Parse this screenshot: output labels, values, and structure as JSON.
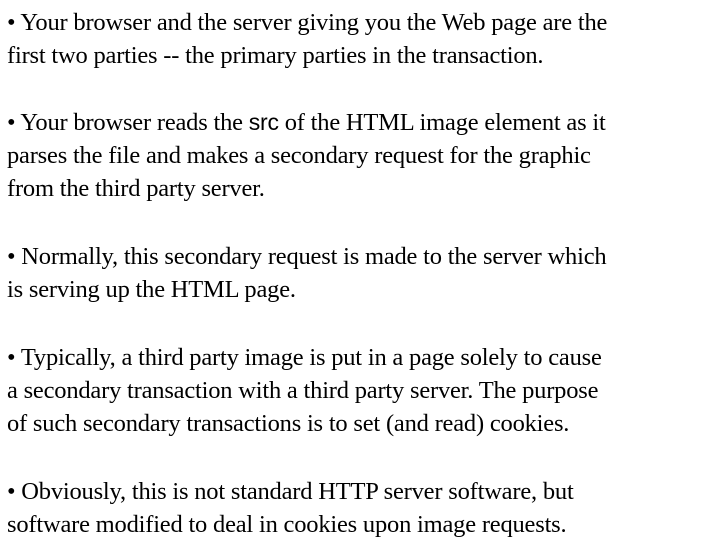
{
  "bullet": "•",
  "paragraphs": [
    {
      "lines": [
        "• Your browser and the server giving you the Web page are the",
        "first two parties -- the primary parties in the transaction."
      ]
    },
    {
      "line1_pre": "• Your browser reads the ",
      "line1_code": "src",
      "line1_post": " of the HTML image element as it",
      "lines": [
        "parses the file and makes a secondary request for the graphic",
        "from the third party server."
      ]
    },
    {
      "lines": [
        "• Normally, this secondary request is made to the server which",
        "is serving up the HTML page."
      ]
    },
    {
      "lines": [
        "• Typically, a third party image is put in a page solely to cause",
        "a secondary transaction with a third party server.  The purpose",
        "of such secondary transactions is to set (and read) cookies."
      ]
    },
    {
      "lines": [
        "• Obviously, this is not standard HTTP server software, but",
        "software modified to deal in cookies upon image requests."
      ]
    }
  ]
}
